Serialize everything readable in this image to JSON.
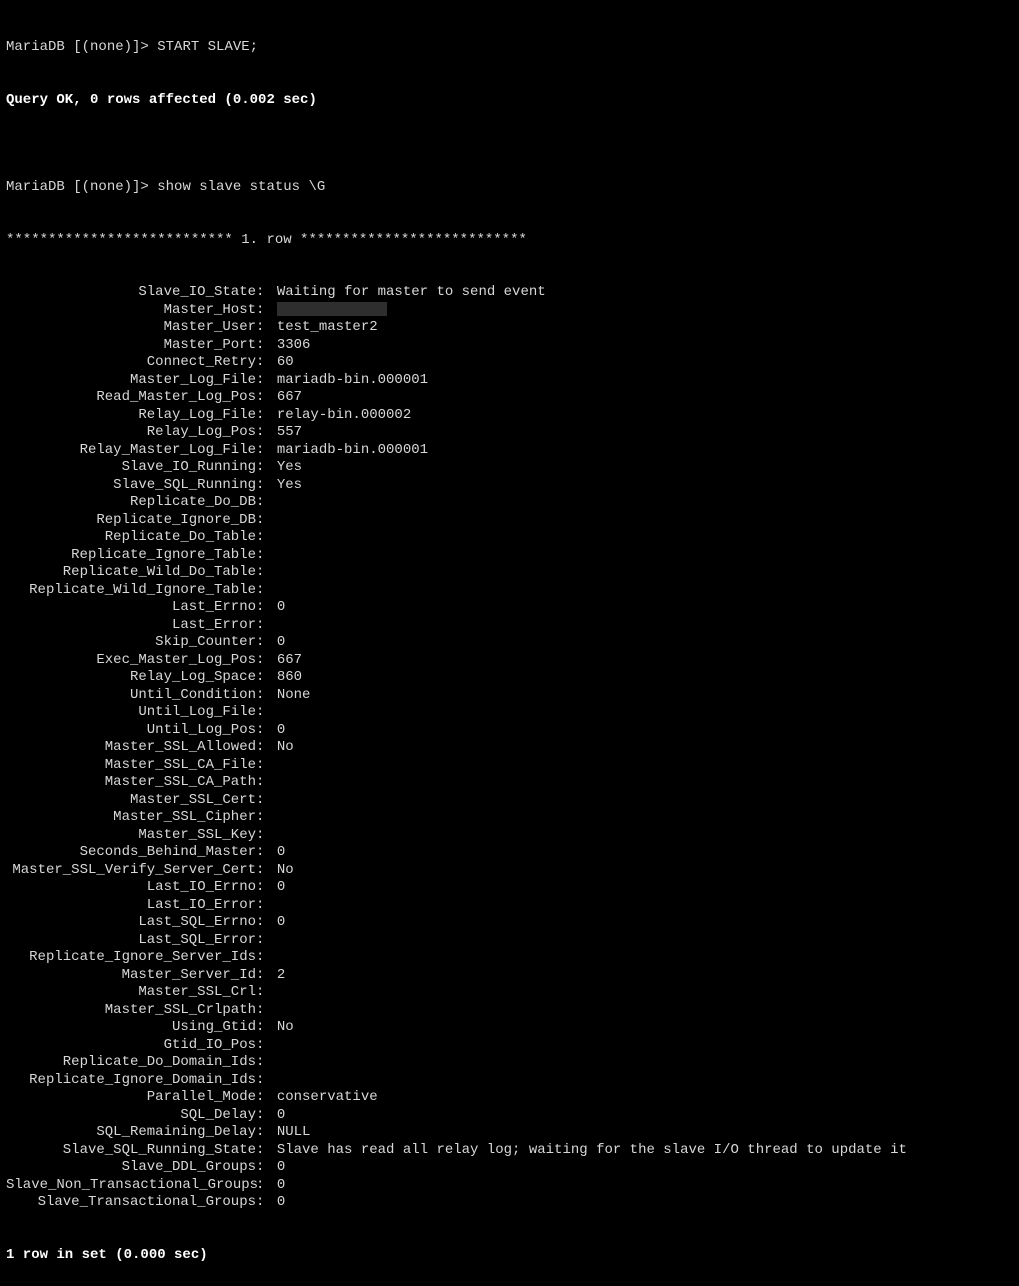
{
  "prompt1_prefix": "MariaDB [(none)]> ",
  "prompt1_cmd": "START SLAVE;",
  "result1": "Query OK, 0 rows affected (0.002 sec)",
  "blank": "",
  "prompt2_prefix": "MariaDB [(none)]> ",
  "prompt2_cmd": "show slave status \\G",
  "row_divider": "*************************** 1. row ***************************",
  "fields": [
    {
      "k": "Slave_IO_State",
      "v": "Waiting for master to send event"
    },
    {
      "k": "Master_Host",
      "v": "",
      "redacted": true
    },
    {
      "k": "Master_User",
      "v": "test_master2"
    },
    {
      "k": "Master_Port",
      "v": "3306"
    },
    {
      "k": "Connect_Retry",
      "v": "60"
    },
    {
      "k": "Master_Log_File",
      "v": "mariadb-bin.000001"
    },
    {
      "k": "Read_Master_Log_Pos",
      "v": "667"
    },
    {
      "k": "Relay_Log_File",
      "v": "relay-bin.000002"
    },
    {
      "k": "Relay_Log_Pos",
      "v": "557"
    },
    {
      "k": "Relay_Master_Log_File",
      "v": "mariadb-bin.000001"
    },
    {
      "k": "Slave_IO_Running",
      "v": "Yes"
    },
    {
      "k": "Slave_SQL_Running",
      "v": "Yes"
    },
    {
      "k": "Replicate_Do_DB",
      "v": ""
    },
    {
      "k": "Replicate_Ignore_DB",
      "v": ""
    },
    {
      "k": "Replicate_Do_Table",
      "v": ""
    },
    {
      "k": "Replicate_Ignore_Table",
      "v": ""
    },
    {
      "k": "Replicate_Wild_Do_Table",
      "v": ""
    },
    {
      "k": "Replicate_Wild_Ignore_Table",
      "v": ""
    },
    {
      "k": "Last_Errno",
      "v": "0"
    },
    {
      "k": "Last_Error",
      "v": ""
    },
    {
      "k": "Skip_Counter",
      "v": "0"
    },
    {
      "k": "Exec_Master_Log_Pos",
      "v": "667"
    },
    {
      "k": "Relay_Log_Space",
      "v": "860"
    },
    {
      "k": "Until_Condition",
      "v": "None"
    },
    {
      "k": "Until_Log_File",
      "v": ""
    },
    {
      "k": "Until_Log_Pos",
      "v": "0"
    },
    {
      "k": "Master_SSL_Allowed",
      "v": "No"
    },
    {
      "k": "Master_SSL_CA_File",
      "v": ""
    },
    {
      "k": "Master_SSL_CA_Path",
      "v": ""
    },
    {
      "k": "Master_SSL_Cert",
      "v": ""
    },
    {
      "k": "Master_SSL_Cipher",
      "v": ""
    },
    {
      "k": "Master_SSL_Key",
      "v": ""
    },
    {
      "k": "Seconds_Behind_Master",
      "v": "0"
    },
    {
      "k": "Master_SSL_Verify_Server_Cert",
      "v": "No"
    },
    {
      "k": "Last_IO_Errno",
      "v": "0"
    },
    {
      "k": "Last_IO_Error",
      "v": ""
    },
    {
      "k": "Last_SQL_Errno",
      "v": "0"
    },
    {
      "k": "Last_SQL_Error",
      "v": ""
    },
    {
      "k": "Replicate_Ignore_Server_Ids",
      "v": ""
    },
    {
      "k": "Master_Server_Id",
      "v": "2"
    },
    {
      "k": "Master_SSL_Crl",
      "v": ""
    },
    {
      "k": "Master_SSL_Crlpath",
      "v": ""
    },
    {
      "k": "Using_Gtid",
      "v": "No"
    },
    {
      "k": "Gtid_IO_Pos",
      "v": ""
    },
    {
      "k": "Replicate_Do_Domain_Ids",
      "v": ""
    },
    {
      "k": "Replicate_Ignore_Domain_Ids",
      "v": ""
    },
    {
      "k": "Parallel_Mode",
      "v": "conservative"
    },
    {
      "k": "SQL_Delay",
      "v": "0"
    },
    {
      "k": "SQL_Remaining_Delay",
      "v": "NULL"
    },
    {
      "k": "Slave_SQL_Running_State",
      "v": "Slave has read all relay log; waiting for the slave I/O thread to update it"
    },
    {
      "k": "Slave_DDL_Groups",
      "v": "0"
    },
    {
      "k": "Slave_Non_Transactional_Groups",
      "v": "0"
    },
    {
      "k": "Slave_Transactional_Groups",
      "v": "0"
    }
  ],
  "footer": "1 row in set (0.000 sec)"
}
